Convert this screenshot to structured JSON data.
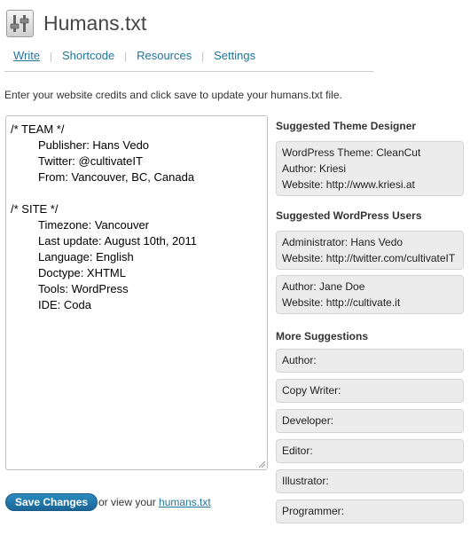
{
  "header": {
    "title": "Humans.txt",
    "icon": "sliders-icon"
  },
  "nav": {
    "tabs": [
      {
        "label": "Write",
        "active": true
      },
      {
        "label": "Shortcode",
        "active": false
      },
      {
        "label": "Resources",
        "active": false
      },
      {
        "label": "Settings",
        "active": false
      }
    ]
  },
  "intro": "Enter your website credits and click save to update your humans.txt file.",
  "editor": {
    "lines": [
      "/* TEAM */",
      "Publisher: Hans Vedo",
      "Twitter: @cultivateIT",
      "From: Vancouver, BC, Canada",
      "",
      "/* SITE */",
      "Timezone: Vancouver",
      "Last update: August 10th, 2011",
      "Language: English",
      "Doctype: XHTML",
      "Tools: WordPress",
      "IDE: Coda"
    ]
  },
  "actions": {
    "save_label": "Save Changes",
    "view_text": "or view your",
    "view_link": "humans.txt"
  },
  "sidebar": {
    "theme_designer": {
      "title": "Suggested Theme Designer",
      "lines": [
        "WordPress Theme: CleanCut",
        "Author: Kriesi",
        "Website: http://www.kriesi.at"
      ]
    },
    "wp_users": {
      "title": "Suggested WordPress Users",
      "users": [
        [
          "Administrator: Hans Vedo",
          "Website: http://twitter.com/cultivateIT"
        ],
        [
          "Author: Jane Doe",
          "Website: http://cultivate.it"
        ]
      ]
    },
    "more": {
      "title": "More Suggestions",
      "items": [
        "Author:",
        "Copy Writer:",
        "Developer:",
        "Editor:",
        "Illustrator:",
        "Programmer:"
      ]
    }
  },
  "colors": {
    "link": "#21759b",
    "button": "#21759b",
    "box_bg": "#ececec"
  }
}
